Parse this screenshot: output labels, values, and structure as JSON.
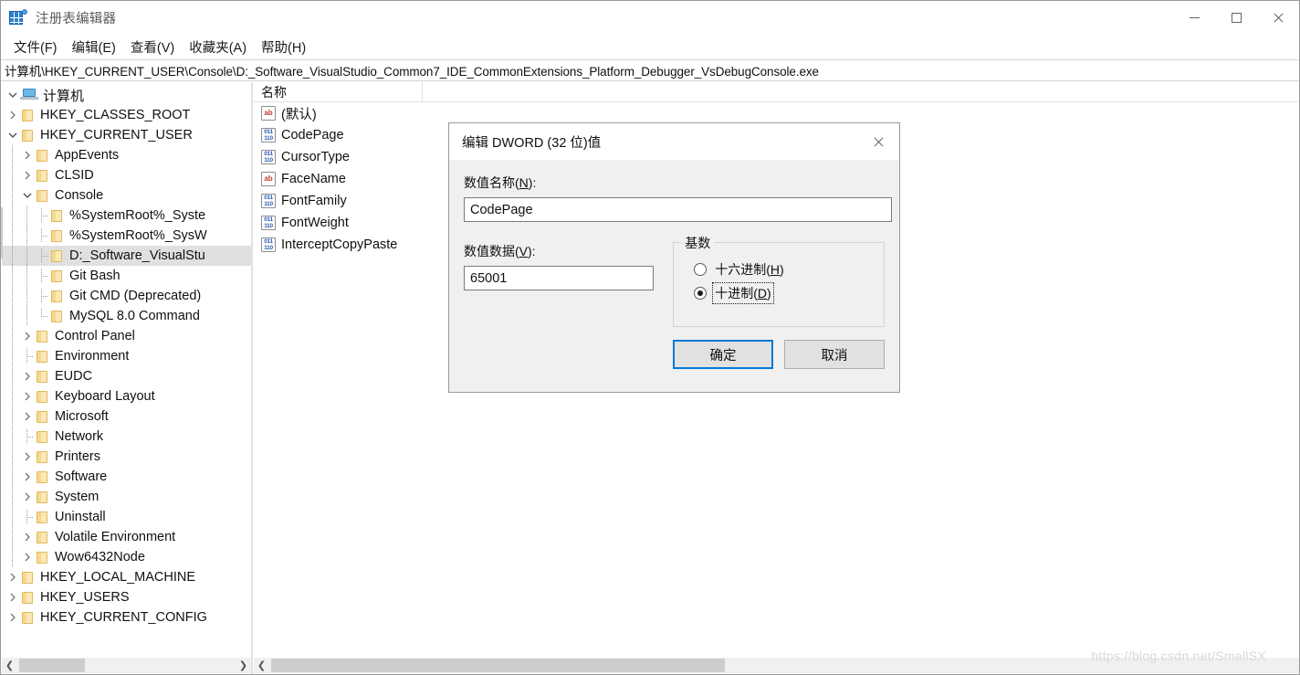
{
  "window": {
    "title": "注册表编辑器",
    "icon": "registry-editor-icon",
    "minimize_label": "最小化",
    "maximize_label": "最大化",
    "close_label": "关闭"
  },
  "menubar": {
    "items": [
      {
        "label": "文件(F)",
        "name": "menu-file"
      },
      {
        "label": "编辑(E)",
        "name": "menu-edit"
      },
      {
        "label": "查看(V)",
        "name": "menu-view"
      },
      {
        "label": "收藏夹(A)",
        "name": "menu-favorites"
      },
      {
        "label": "帮助(H)",
        "name": "menu-help"
      }
    ]
  },
  "address": {
    "path": "计算机\\HKEY_CURRENT_USER\\Console\\D:_Software_VisualStudio_Common7_IDE_CommonExtensions_Platform_Debugger_VsDebugConsole.exe"
  },
  "tree": {
    "nodes": [
      {
        "label": "计算机",
        "indent": 0,
        "expander": "expanded",
        "icon": "computer-icon",
        "selected": false
      },
      {
        "label": "HKEY_CLASSES_ROOT",
        "indent": 1,
        "expander": "collapsed",
        "icon": "folder-icon",
        "selected": false
      },
      {
        "label": "HKEY_CURRENT_USER",
        "indent": 1,
        "expander": "expanded",
        "icon": "folder-icon",
        "selected": false
      },
      {
        "label": "AppEvents",
        "indent": 2,
        "expander": "collapsed",
        "icon": "folder-icon",
        "selected": false
      },
      {
        "label": "CLSID",
        "indent": 2,
        "expander": "collapsed",
        "icon": "folder-icon",
        "selected": false
      },
      {
        "label": "Console",
        "indent": 2,
        "expander": "expanded",
        "icon": "folder-icon",
        "selected": false
      },
      {
        "label": "%SystemRoot%_Syste",
        "indent": 3,
        "expander": "leaf",
        "icon": "folder-icon",
        "selected": false
      },
      {
        "label": "%SystemRoot%_SysW",
        "indent": 3,
        "expander": "leaf",
        "icon": "folder-icon",
        "selected": false
      },
      {
        "label": "D:_Software_VisualStu",
        "indent": 3,
        "expander": "leaf",
        "icon": "folder-icon",
        "selected": true
      },
      {
        "label": "Git Bash",
        "indent": 3,
        "expander": "leaf",
        "icon": "folder-icon",
        "selected": false
      },
      {
        "label": "Git CMD (Deprecated)",
        "indent": 3,
        "expander": "leaf",
        "icon": "folder-icon",
        "selected": false
      },
      {
        "label": "MySQL 8.0 Command",
        "indent": 3,
        "expander": "leaf",
        "icon": "folder-icon",
        "selected": false
      },
      {
        "label": "Control Panel",
        "indent": 2,
        "expander": "collapsed",
        "icon": "folder-icon",
        "selected": false
      },
      {
        "label": "Environment",
        "indent": 2,
        "expander": "leaf",
        "icon": "folder-icon",
        "selected": false
      },
      {
        "label": "EUDC",
        "indent": 2,
        "expander": "collapsed",
        "icon": "folder-icon",
        "selected": false
      },
      {
        "label": "Keyboard Layout",
        "indent": 2,
        "expander": "collapsed",
        "icon": "folder-icon",
        "selected": false
      },
      {
        "label": "Microsoft",
        "indent": 2,
        "expander": "collapsed",
        "icon": "folder-icon",
        "selected": false
      },
      {
        "label": "Network",
        "indent": 2,
        "expander": "leaf",
        "icon": "folder-icon",
        "selected": false
      },
      {
        "label": "Printers",
        "indent": 2,
        "expander": "collapsed",
        "icon": "folder-icon",
        "selected": false
      },
      {
        "label": "Software",
        "indent": 2,
        "expander": "collapsed",
        "icon": "folder-icon",
        "selected": false
      },
      {
        "label": "System",
        "indent": 2,
        "expander": "collapsed",
        "icon": "folder-icon",
        "selected": false
      },
      {
        "label": "Uninstall",
        "indent": 2,
        "expander": "leaf",
        "icon": "folder-icon",
        "selected": false
      },
      {
        "label": "Volatile Environment",
        "indent": 2,
        "expander": "collapsed",
        "icon": "folder-icon",
        "selected": false
      },
      {
        "label": "Wow6432Node",
        "indent": 2,
        "expander": "collapsed",
        "icon": "folder-icon",
        "selected": false
      },
      {
        "label": "HKEY_LOCAL_MACHINE",
        "indent": 1,
        "expander": "collapsed",
        "icon": "folder-icon",
        "selected": false
      },
      {
        "label": "HKEY_USERS",
        "indent": 1,
        "expander": "collapsed",
        "icon": "folder-icon",
        "selected": false
      },
      {
        "label": "HKEY_CURRENT_CONFIG",
        "indent": 1,
        "expander": "collapsed",
        "icon": "folder-icon",
        "selected": false
      }
    ]
  },
  "list": {
    "columns": [
      "名称"
    ],
    "rows": [
      {
        "name": "(默认)",
        "icon": "string-value-icon"
      },
      {
        "name": "CodePage",
        "icon": "dword-value-icon"
      },
      {
        "name": "CursorType",
        "icon": "dword-value-icon"
      },
      {
        "name": "FaceName",
        "icon": "string-value-icon"
      },
      {
        "name": "FontFamily",
        "icon": "dword-value-icon"
      },
      {
        "name": "FontWeight",
        "icon": "dword-value-icon"
      },
      {
        "name": "InterceptCopyPaste",
        "icon": "dword-value-icon"
      }
    ]
  },
  "dialog": {
    "title": "编辑 DWORD (32 位)值",
    "name_label": "数值名称(",
    "name_accel": "N",
    "name_label_end": "):",
    "name_value": "CodePage",
    "data_label": "数值数据(",
    "data_accel": "V",
    "data_label_end": "):",
    "data_value": "65001",
    "base_group_label": "基数",
    "radio_hex_label": "十六进制(",
    "radio_hex_accel": "H",
    "radio_hex_end": ")",
    "radio_hex_selected": false,
    "radio_dec_label": "十进制(",
    "radio_dec_accel": "D",
    "radio_dec_end": ")",
    "radio_dec_selected": true,
    "ok_label": "确定",
    "cancel_label": "取消"
  },
  "watermark": {
    "text": "https://blog.csdn.net/SmallSX"
  },
  "colors": {
    "accent": "#0078d7",
    "selection": "#e0e0e0",
    "dialog_bg": "#f0f0f0",
    "folder": "#fbe8b8",
    "string_icon": "#c43a2c",
    "dword_icon": "#2b5bb5"
  }
}
